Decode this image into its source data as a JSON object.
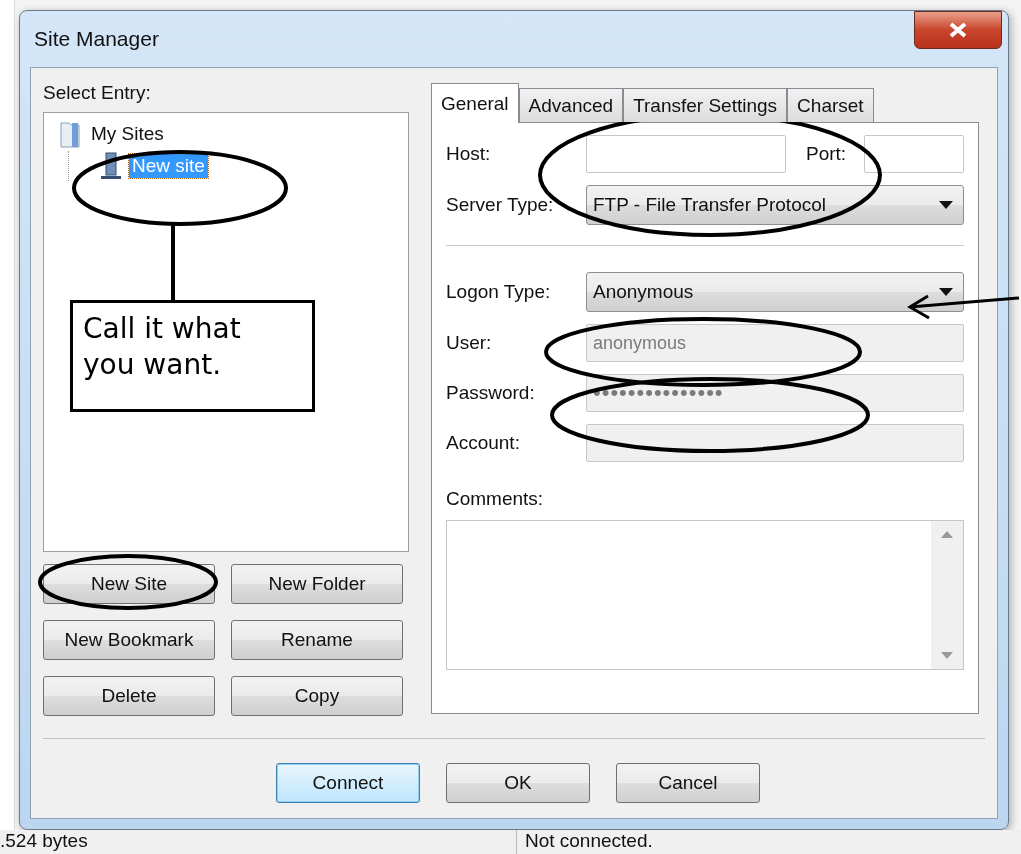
{
  "window": {
    "title": "Site Manager"
  },
  "select_entry": {
    "label": "Select Entry:"
  },
  "tree": [
    {
      "label": "My Sites",
      "kind": "folder",
      "expanded": true,
      "selected": false,
      "children": [
        {
          "label": "New site",
          "kind": "site",
          "selected": true
        }
      ]
    }
  ],
  "entry_buttons": [
    {
      "label": "New Site"
    },
    {
      "label": "New Folder"
    },
    {
      "label": "New Bookmark"
    },
    {
      "label": "Rename"
    },
    {
      "label": "Delete"
    },
    {
      "label": "Copy"
    }
  ],
  "tabs": [
    {
      "label": "General",
      "selected": true
    },
    {
      "label": "Advanced",
      "selected": false
    },
    {
      "label": "Transfer Settings",
      "selected": false
    },
    {
      "label": "Charset",
      "selected": false
    }
  ],
  "general": {
    "host": {
      "label": "Host:"
    },
    "port": {
      "label": "Port:"
    },
    "server_type": {
      "label": "Server Type:",
      "value": "FTP - File Transfer Protocol"
    },
    "logon_type": {
      "label": "Logon Type:",
      "value": "Anonymous"
    },
    "fields": [
      {
        "label": "User:",
        "value": "anonymous",
        "disabled": true
      },
      {
        "label": "Password:",
        "value": "•••••••••••••••",
        "disabled": true
      },
      {
        "label": "Account:",
        "disabled": true
      }
    ],
    "comments": {
      "label": "Comments:"
    }
  },
  "dialog_buttons": [
    {
      "label": "Connect",
      "default": true
    },
    {
      "label": "OK",
      "default": false
    },
    {
      "label": "Cancel",
      "default": false
    }
  ],
  "annotation": {
    "callout": "Call it what you want."
  },
  "status_bar": [
    {
      "text": ".524 bytes"
    },
    {
      "text": "Not connected."
    }
  ]
}
